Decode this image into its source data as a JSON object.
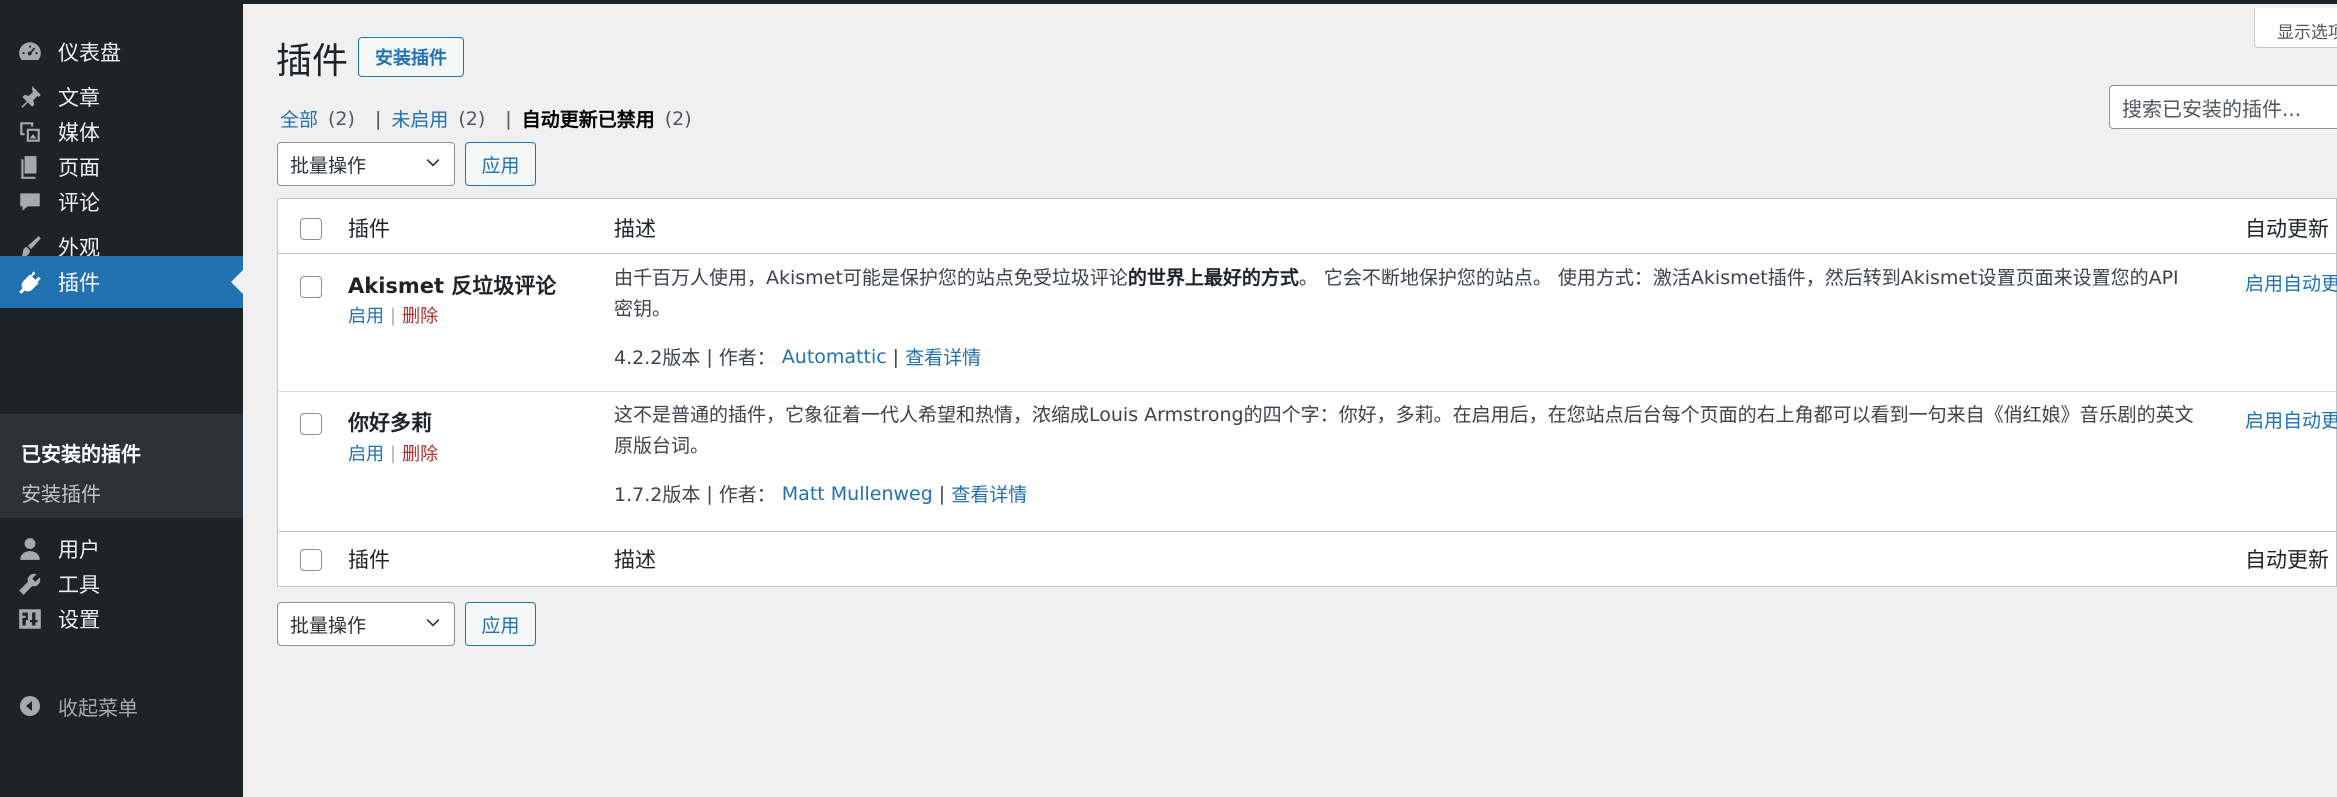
{
  "sidebar": {
    "items": [
      {
        "label": "仪表盘",
        "icon": "dashboard-icon"
      },
      {
        "label": "文章",
        "icon": "pin-icon"
      },
      {
        "label": "媒体",
        "icon": "media-icon"
      },
      {
        "label": "页面",
        "icon": "page-icon"
      },
      {
        "label": "评论",
        "icon": "comment-icon"
      },
      {
        "label": "外观",
        "icon": "paintbrush-icon"
      },
      {
        "label": "插件",
        "icon": "plugin-icon"
      },
      {
        "label": "用户",
        "icon": "user-icon"
      },
      {
        "label": "工具",
        "icon": "wrench-icon"
      },
      {
        "label": "设置",
        "icon": "settings-icon"
      }
    ],
    "submenu": {
      "installed": "已安装的插件",
      "add": "安装插件"
    },
    "collapse": "收起菜单"
  },
  "header": {
    "title": "插件",
    "install_button": "安装插件",
    "screen_options": "显示选项"
  },
  "filters": {
    "all": "全部",
    "all_count": "(2)",
    "inactive": "未启用",
    "inactive_count": "(2)",
    "auto_disabled": "自动更新已禁用",
    "auto_disabled_count": "(2)",
    "sep": "|"
  },
  "search": {
    "placeholder": "搜索已安装的插件..."
  },
  "bulk": {
    "select_label": "批量操作",
    "apply_label": "应用"
  },
  "table": {
    "col_plugin": "插件",
    "col_desc": "描述",
    "col_auto": "自动更新",
    "rows": [
      {
        "name": "Akismet 反垃圾评论",
        "activate": "启用",
        "delete": "删除",
        "desc_part1": "由千百万人使用，Akismet可能是保护您的站点免受垃圾评论",
        "desc_bold": "的世界上最好的方式",
        "desc_part2": "。 它会不断地保护您的站点。 使用方式：激活Akismet插件，然后转到Akismet设置页面来设置您的API密钥。",
        "version": "4.2.2版本",
        "author_label": "作者：",
        "author": "Automattic",
        "details": "查看详情",
        "auto_update": "启用自动更新"
      },
      {
        "name": "你好多莉",
        "activate": "启用",
        "delete": "删除",
        "desc_part1": "这不是普通的插件，它象征着一代人希望和热情，浓缩成Louis Armstrong的四个字：你好，多莉。在启用后，在您站点后台每个页面的右上角都可以看到一句来自《俏红娘》音乐剧的英文原版台词。",
        "version": "1.7.2版本",
        "author_label": "作者：",
        "author": "Matt Mullenweg",
        "details": "查看详情",
        "auto_update": "启用自动更新"
      }
    ]
  }
}
